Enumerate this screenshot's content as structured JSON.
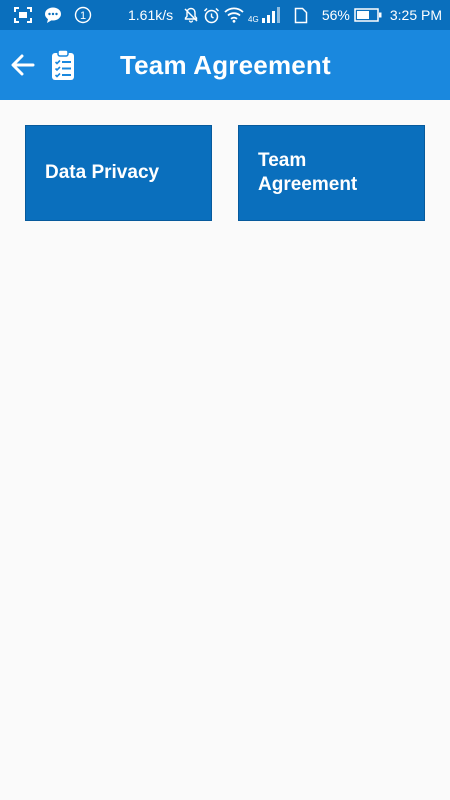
{
  "status_bar": {
    "notification_count": "1",
    "net_speed": "1.61k/s",
    "network_type": "4G",
    "battery_percent": "56%",
    "time": "3:25 PM",
    "icons": [
      "screenshot-icon",
      "chat-bubble-icon",
      "notification-count-icon",
      "mute-bell-icon",
      "alarm-icon",
      "wifi-icon",
      "signal-icon",
      "sim-icon",
      "battery-icon"
    ]
  },
  "app_bar": {
    "title": "Team Agreement",
    "back_icon": "arrow-left-icon",
    "section_icon": "clipboard-checklist-icon",
    "color": "#1a88de"
  },
  "tiles": [
    {
      "label": "Data Privacy"
    },
    {
      "label": "Team\nAgreement"
    }
  ],
  "colors": {
    "status_bar": "#0a6fbd",
    "tile": "#0a6fbd",
    "background": "#fafafa"
  }
}
